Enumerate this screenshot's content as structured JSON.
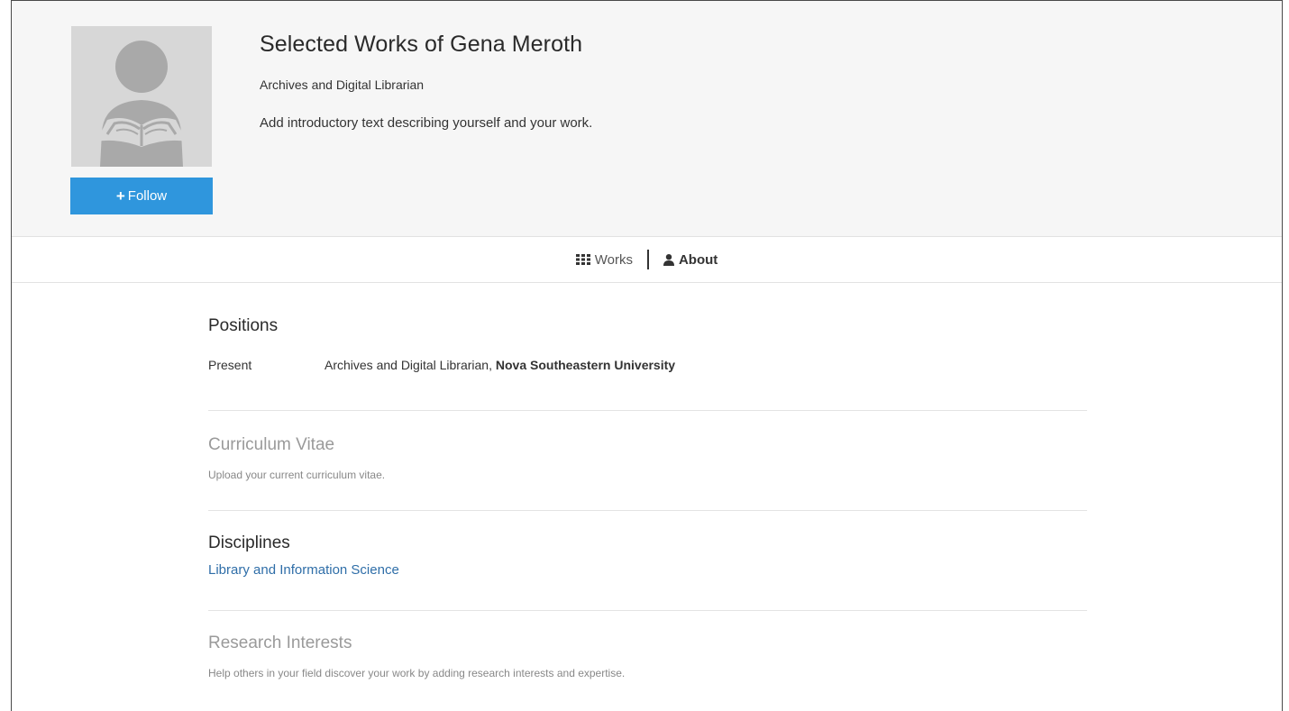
{
  "profile": {
    "title": "Selected Works of Gena Meroth",
    "subtitle": "Archives and Digital Librarian",
    "intro": "Add introductory text describing yourself and your work.",
    "follow_label": "Follow"
  },
  "nav": {
    "works_label": "Works",
    "about_label": "About",
    "works_icon": "grid-icon",
    "about_icon": "user-icon"
  },
  "positions": {
    "title": "Positions",
    "items": [
      {
        "period": "Present",
        "role": "Archives and Digital Librarian, ",
        "organization": "Nova Southeastern University"
      }
    ]
  },
  "cv": {
    "title": "Curriculum Vitae",
    "help": "Upload your current curriculum vitae."
  },
  "disciplines": {
    "title": "Disciplines",
    "items": [
      "Library and Information Science"
    ]
  },
  "research": {
    "title": "Research Interests",
    "help": "Help others in your field discover your work by adding research interests and expertise."
  },
  "colors": {
    "accent": "#2f96dd",
    "link": "#2f6ea8",
    "header_bg": "#f6f6f6"
  }
}
